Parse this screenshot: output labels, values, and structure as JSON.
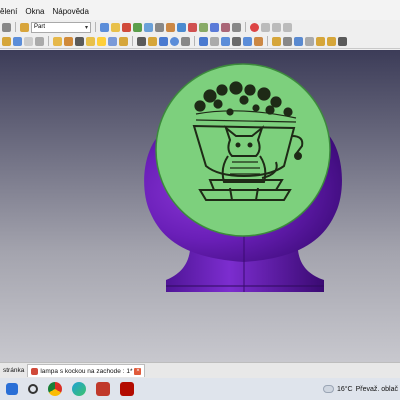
{
  "menu": {
    "items": [
      "ělení",
      "Okna",
      "Nápověda"
    ]
  },
  "toolbar": {
    "workbench": "Part",
    "row1_colors": [
      "#888",
      "#d8a53b",
      "#fff",
      "#5b8dd9",
      "#e8c04a",
      "#d04a3a",
      "#5a9e4a",
      "#6aa0d8",
      "#888",
      "#c84",
      "#4a8ad0",
      "#d05050",
      "#8a6",
      "#5a7ad8",
      "#a67",
      "#888",
      "#d6a63a",
      "#6a6a6a",
      "#d44",
      "#bbb",
      "#bbb",
      "#bbb"
    ],
    "row2_colors": [
      "#d6a63a",
      "#5b8dd9",
      "#ccc",
      "#aaa",
      "#e6b84a",
      "#d08a3a",
      "#5a5a5a",
      "#e8c04a",
      "#ffcf3a",
      "#7a9ad8",
      "#d6a63a",
      "#5a5a5a",
      "#d6a63a",
      "#4a7ad0",
      "#5b8dd9",
      "#888",
      "#4a7ad0",
      "#aaa",
      "#5b8dd9",
      "#6a6a6a",
      "#5b8dd9",
      "#c84",
      "#d6a63a",
      "#888",
      "#5a8ad0",
      "#aaa",
      "#d6a63a",
      "#d6a63a",
      "#5a5a5a"
    ]
  },
  "mdi_tabs": [
    {
      "label": "stránka",
      "active": false
    },
    {
      "label": "lampa s kockou na zachode : 1*",
      "active": true
    }
  ],
  "tab_close_glyph": "×",
  "taskbar": {
    "icons": [
      "start-icon",
      "search-icon",
      "chrome-icon",
      "edge-icon",
      "freecad-icon",
      "acrobat-icon"
    ],
    "temperature": "16°C",
    "weather_text": "Převaž. oblač"
  }
}
